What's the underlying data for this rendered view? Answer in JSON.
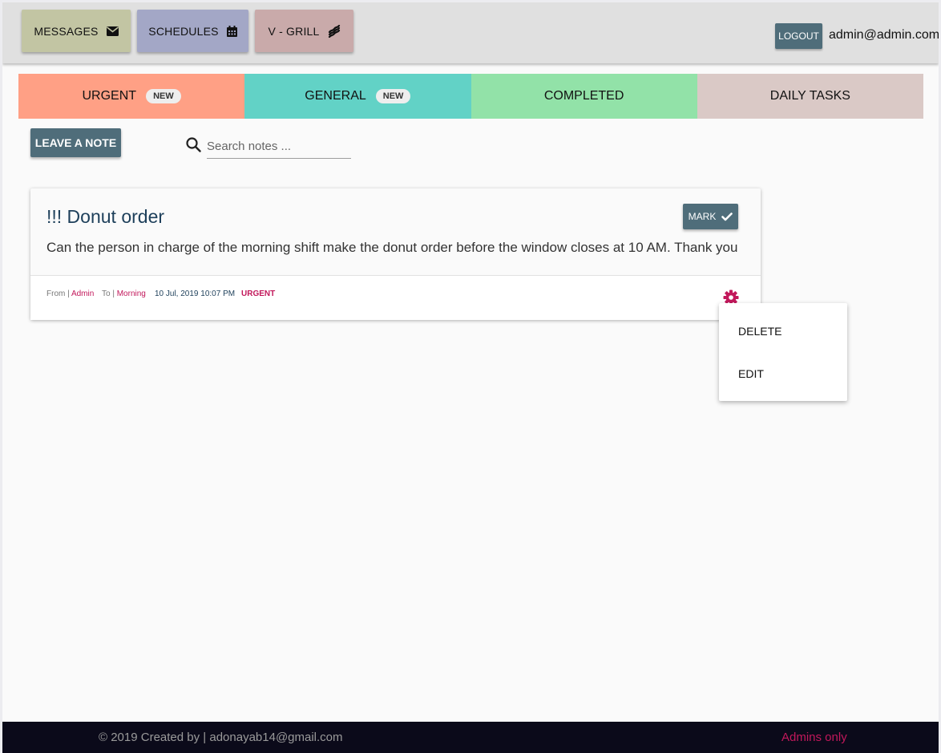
{
  "topbar": {
    "messages_label": "MESSAGES",
    "schedules_label": "SCHEDULES",
    "vgrill_label": "V - GRILL",
    "logout_label": "LOGOUT",
    "user_email": "admin@admin.com",
    "icons": {
      "messages": "envelope-icon",
      "schedules": "calendar-icon",
      "vgrill": "bacon-icon"
    }
  },
  "tabs": [
    {
      "label": "URGENT",
      "badge": "NEW",
      "color": "#ffa085"
    },
    {
      "label": "GENERAL",
      "badge": "NEW",
      "color": "#62d2c6"
    },
    {
      "label": "COMPLETED",
      "color": "#92e2a8"
    },
    {
      "label": "DAILY TASKS",
      "color": "#dac9c6"
    }
  ],
  "actions": {
    "leave_note_label": "LEAVE A NOTE",
    "search_placeholder": "Search notes ..."
  },
  "note": {
    "title": "!!! Donut order",
    "body": "Can the person in charge of the morning shift make the donut order before the window closes at 10 AM. Thank you",
    "mark_label": "MARK",
    "from_label": "From |",
    "from_value": "Admin",
    "to_label": "To |",
    "to_value": "Morning",
    "date": "10 Jul, 2019 10:07 PM",
    "priority": "URGENT"
  },
  "dropdown": {
    "items": [
      "DELETE",
      "EDIT"
    ]
  },
  "footer": {
    "credit": "© 2019 Created by | adonayab14@gmail.com",
    "admins_only": "Admins only"
  },
  "colors": {
    "accent": "#4f6d7a",
    "pink": "#c2185b",
    "footer_bg": "#0b0a1a"
  }
}
